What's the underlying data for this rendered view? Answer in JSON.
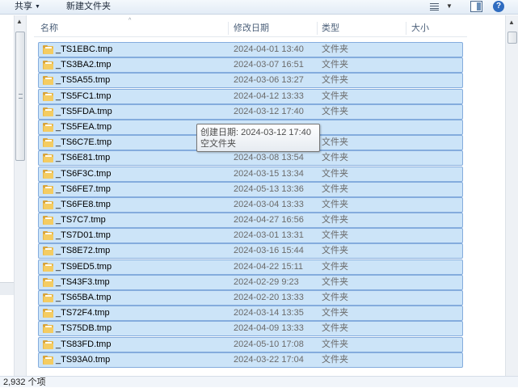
{
  "toolbar": {
    "share_label": "共享",
    "share_arrow": "▼",
    "new_folder_label": "新建文件夹",
    "view_caret": "▼",
    "help_label": "?"
  },
  "columns": {
    "name": "名称",
    "date": "修改日期",
    "type": "类型",
    "size": "大小",
    "sort_indicator": "^"
  },
  "rows": [
    {
      "name": "_TS1EBC.tmp",
      "date": "2024-04-01 13:40",
      "type": "文件夹"
    },
    {
      "name": "_TS3BA2.tmp",
      "date": "2024-03-07 16:51",
      "type": "文件夹"
    },
    {
      "name": "_TS5A55.tmp",
      "date": "2024-03-06 13:27",
      "type": "文件夹"
    },
    {
      "name": "_TS5FC1.tmp",
      "date": "2024-04-12 13:33",
      "type": "文件夹"
    },
    {
      "name": "_TS5FDA.tmp",
      "date": "2024-03-12 17:40",
      "type": "文件夹"
    },
    {
      "name": "_TS5FEA.tmp",
      "date": "",
      "type": ""
    },
    {
      "name": "_TS6C7E.tmp",
      "date": "",
      "type": "文件夹"
    },
    {
      "name": "_TS6E81.tmp",
      "date": "2024-03-08 13:54",
      "type": "文件夹"
    },
    {
      "name": "_TS6F3C.tmp",
      "date": "2024-03-15 13:34",
      "type": "文件夹"
    },
    {
      "name": "_TS6FE7.tmp",
      "date": "2024-05-13 13:36",
      "type": "文件夹"
    },
    {
      "name": "_TS6FE8.tmp",
      "date": "2024-03-04 13:33",
      "type": "文件夹"
    },
    {
      "name": "_TS7C7.tmp",
      "date": "2024-04-27 16:56",
      "type": "文件夹"
    },
    {
      "name": "_TS7D01.tmp",
      "date": "2024-03-01 13:31",
      "type": "文件夹"
    },
    {
      "name": "_TS8E72.tmp",
      "date": "2024-03-16 15:44",
      "type": "文件夹"
    },
    {
      "name": "_TS9ED5.tmp",
      "date": "2024-04-22 15:11",
      "type": "文件夹"
    },
    {
      "name": "_TS43F3.tmp",
      "date": "2024-02-29 9:23",
      "type": "文件夹"
    },
    {
      "name": "_TS65BA.tmp",
      "date": "2024-02-20 13:33",
      "type": "文件夹"
    },
    {
      "name": "_TS72F4.tmp",
      "date": "2024-03-14 13:35",
      "type": "文件夹"
    },
    {
      "name": "_TS75DB.tmp",
      "date": "2024-04-09 13:33",
      "type": "文件夹"
    },
    {
      "name": "_TS83FD.tmp",
      "date": "2024-05-10 17:08",
      "type": "文件夹"
    },
    {
      "name": "_TS93A0.tmp",
      "date": "2024-03-22 17:04",
      "type": "文件夹"
    }
  ],
  "tooltip": {
    "created": "创建日期: 2024-03-12 17:40",
    "detail": "空文件夹"
  },
  "status": {
    "item_count": "2,932 个项"
  },
  "colors": {
    "selection_fill": "#cce4f8",
    "selection_border": "#84acdd",
    "folder": "#f4cc62"
  }
}
